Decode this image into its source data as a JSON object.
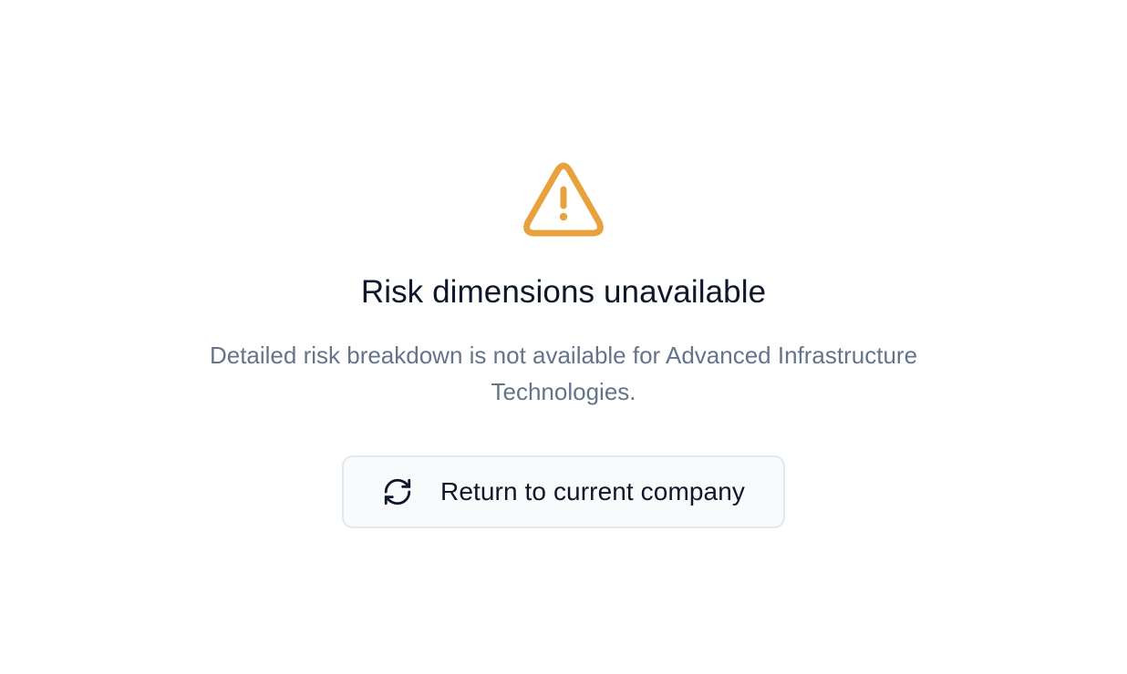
{
  "empty_state": {
    "icon": "warning-triangle-icon",
    "icon_color": "#E8A23D",
    "title": "Risk dimensions unavailable",
    "description": "Detailed risk breakdown is not available for Advanced Infrastructure Technologies.",
    "action": {
      "icon": "refresh-icon",
      "label": "Return to current company"
    }
  }
}
